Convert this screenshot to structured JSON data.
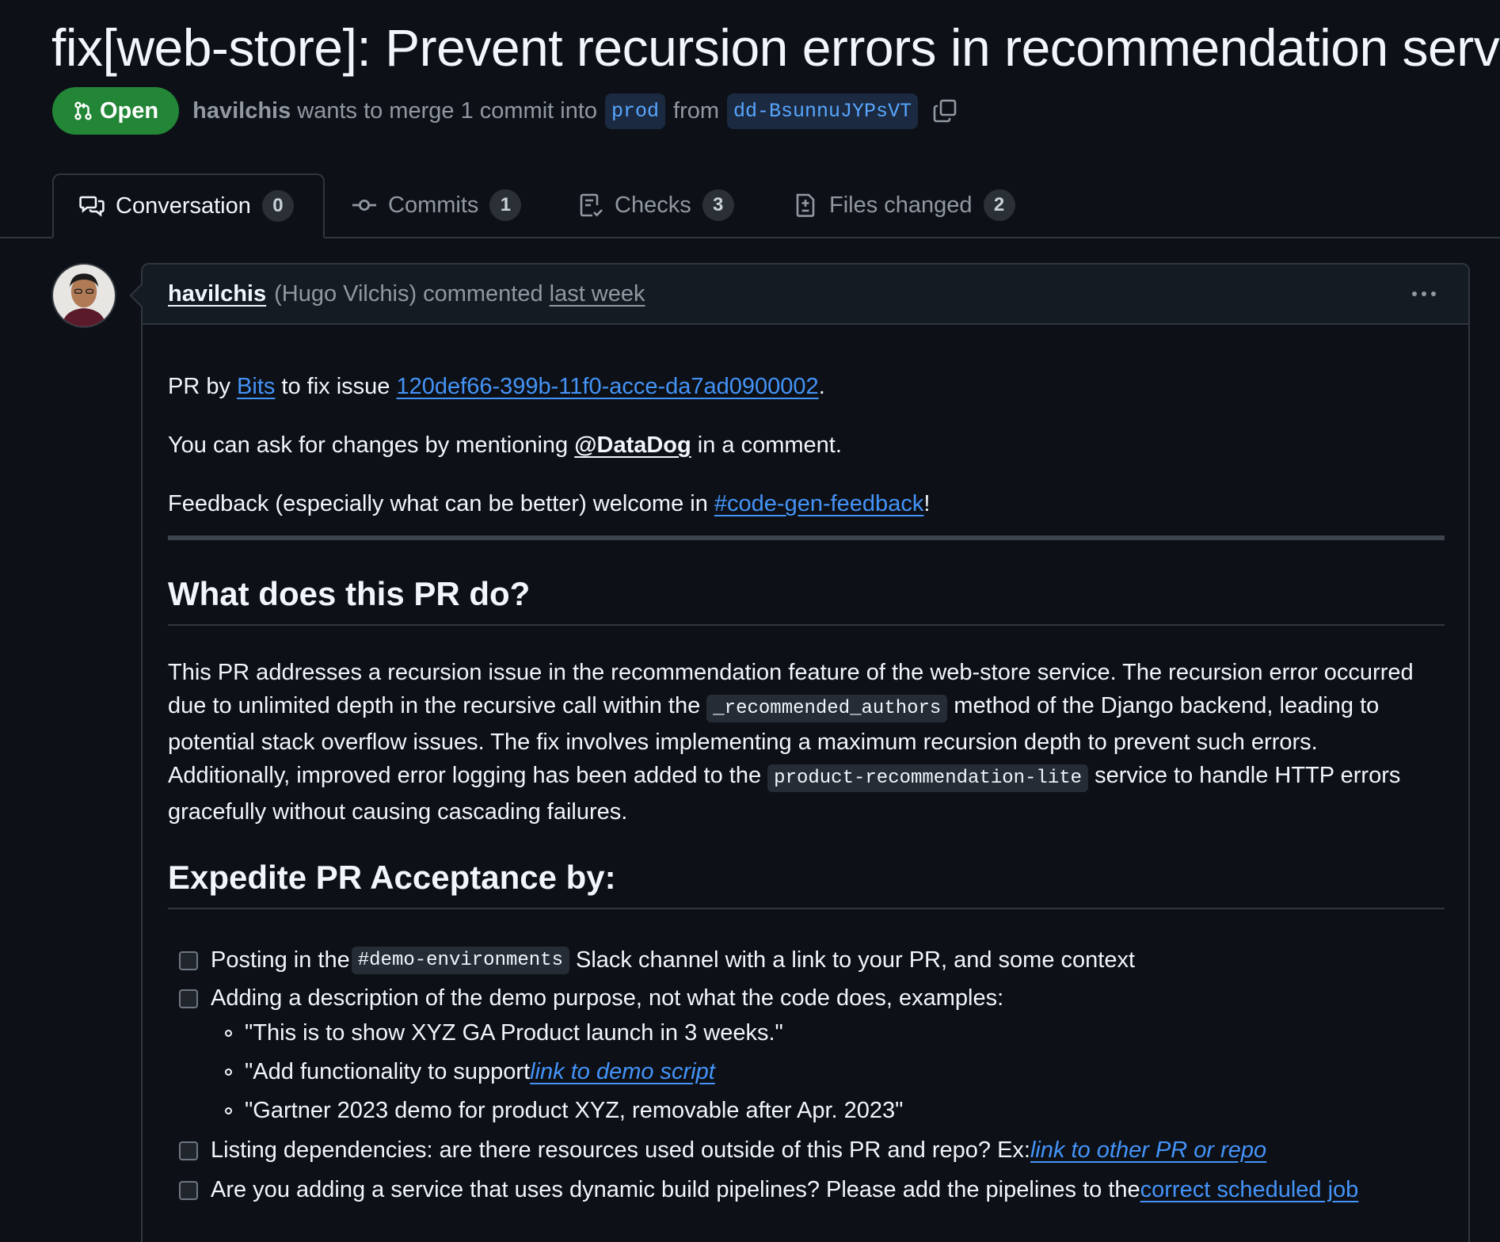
{
  "pr": {
    "title": "fix[web-store]: Prevent recursion errors in recommendation service",
    "state": "Open",
    "author": "havilchis",
    "merge_text_1": "wants to merge 1 commit into",
    "base_branch": "prod",
    "merge_text_2": "from",
    "head_branch": "dd-BsunnuJYPsVT"
  },
  "tabs": [
    {
      "label": "Conversation",
      "count": "0",
      "icon": "comment-discussion-icon"
    },
    {
      "label": "Commits",
      "count": "1",
      "icon": "git-commit-icon"
    },
    {
      "label": "Checks",
      "count": "3",
      "icon": "checklist-icon"
    },
    {
      "label": "Files changed",
      "count": "2",
      "icon": "file-diff-icon"
    }
  ],
  "comment": {
    "author": "havilchis",
    "author_full": "(Hugo Vilchis)",
    "action": "commented",
    "time": "last week",
    "intro": {
      "p1_a": "PR by ",
      "p1_link": "Bits",
      "p1_b": " to fix issue ",
      "p1_issue": "120def66-399b-11f0-acce-da7ad0900002",
      "p1_c": ".",
      "p2_a": "You can ask for changes by mentioning ",
      "p2_mention": "@DataDog",
      "p2_b": " in a comment.",
      "p3_a": "Feedback (especially what can be better) welcome in ",
      "p3_link": "#code-gen-feedback",
      "p3_b": "!"
    },
    "section1": {
      "heading": "What does this PR do?",
      "l1": "This PR addresses a recursion issue in the recommendation feature of the web-store service. The recursion error occurred",
      "l2_a": "due to unlimited depth in the recursive call within the ",
      "l2_code": "_recommended_authors",
      "l2_b": " method of the Django backend, leading to",
      "l3": "potential stack overflow issues. The fix involves implementing a maximum recursion depth to prevent such errors.",
      "l4_a": "Additionally, improved error logging has been added to the ",
      "l4_code": "product-recommendation-lite",
      "l4_b": " service to handle HTTP errors",
      "l5": "gracefully without causing cascading failures."
    },
    "section2": {
      "heading": "Expedite PR Acceptance by:",
      "t1_a": "Posting in the ",
      "t1_code": "#demo-environments",
      "t1_b": " Slack channel with a link to your PR, and some context",
      "t2": "Adding a description of the demo purpose, not what the code does, examples:",
      "s1": "\"This is to show XYZ GA Product launch in 3 weeks.\"",
      "s2_a": "\"Add functionality to support ",
      "s2_link": "link to demo script",
      "s3": "\"Gartner 2023 demo for product XYZ, removable after Apr. 2023\"",
      "t3_a": "Listing dependencies: are there resources used outside of this PR and repo? Ex: ",
      "t3_link": "link to other PR or repo",
      "t4_a": "Are you adding a service that uses dynamic build pipelines? Please add the pipelines to the ",
      "t4_link": "correct scheduled job"
    }
  },
  "colors": {
    "background": "#0d1117",
    "open_badge": "#238636",
    "link": "#4493f8",
    "border": "#30363d"
  }
}
